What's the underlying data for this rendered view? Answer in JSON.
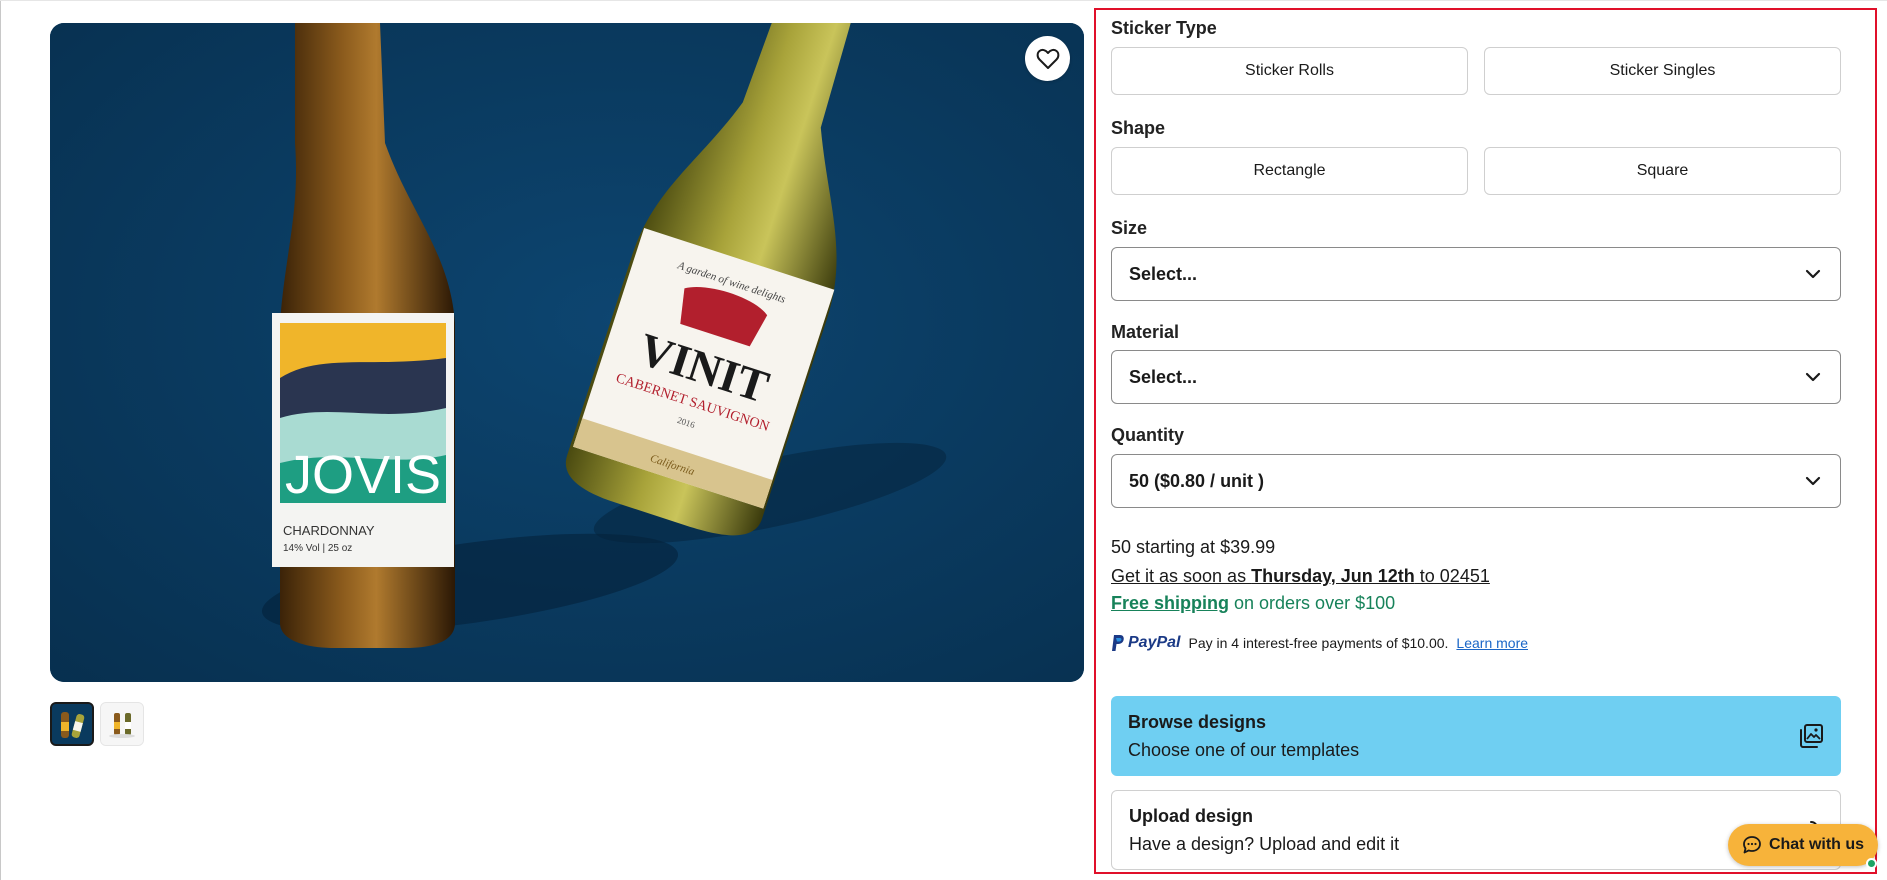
{
  "sticker_type": {
    "label": "Sticker Type",
    "options": [
      "Sticker Rolls",
      "Sticker Singles"
    ]
  },
  "shape": {
    "label": "Shape",
    "options": [
      "Rectangle",
      "Square"
    ]
  },
  "size": {
    "label": "Size",
    "selected": "Select..."
  },
  "material": {
    "label": "Material",
    "selected": "Select..."
  },
  "quantity": {
    "label": "Quantity",
    "selected": "50 ($0.80 / unit )"
  },
  "pricing": {
    "starting": "50 starting at $39.99",
    "delivery_prefix": "Get it as soon as ",
    "delivery_date": "Thursday, Jun 12th",
    "delivery_suffix": " to 02451",
    "free_shipping": "Free shipping",
    "free_shipping_suffix": " on orders over $100"
  },
  "paypal": {
    "logo": "PayPal",
    "text": "Pay in 4 interest-free payments of $10.00.",
    "learn_more": "Learn more"
  },
  "browse": {
    "title": "Browse designs",
    "subtitle": "Choose one of our templates"
  },
  "upload": {
    "title": "Upload design",
    "subtitle": "Have a design? Upload and edit it"
  },
  "chat": {
    "label": "Chat with us"
  },
  "product_image": {
    "bottle_left": {
      "brand": "JOVIS",
      "variety": "CHARDONNAY",
      "details": "14% Vol | 25 oz"
    },
    "bottle_right": {
      "tagline": "A garden of wine delights",
      "brand": "VINIT",
      "variety": "CABERNET SAUVIGNON",
      "year": "2016",
      "region": "California"
    }
  },
  "colors": {
    "accent_blue": "#6fcff2",
    "chat_orange": "#f7b33a",
    "shipping_green": "#17825a",
    "highlight_border": "#e0102a",
    "image_background": "#0a3a5e"
  }
}
